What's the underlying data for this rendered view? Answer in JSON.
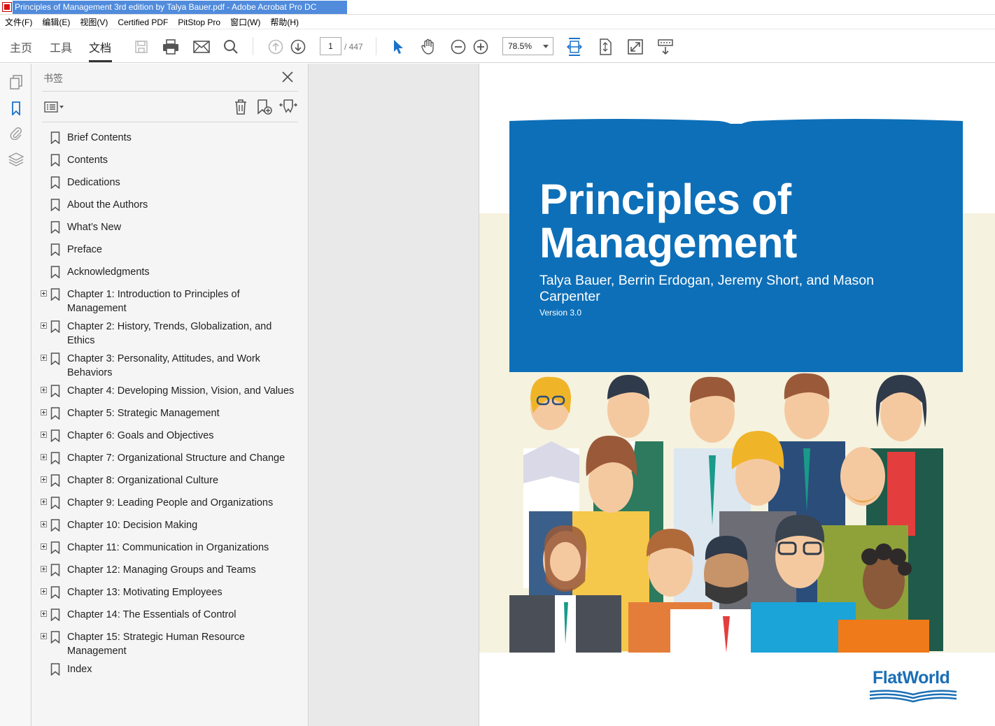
{
  "window": {
    "title": "Principles of Management 3rd edition by Talya Bauer.pdf - Adobe Acrobat Pro DC"
  },
  "menubar": [
    "文件(F)",
    "编辑(E)",
    "视图(V)",
    "Certified PDF",
    "PitStop Pro",
    "窗口(W)",
    "帮助(H)"
  ],
  "toolbar": {
    "tabs": [
      "主页",
      "工具",
      "文档"
    ],
    "active_tab": "文档",
    "page_current": "1",
    "page_total": "/ 447",
    "zoom": "78.5%"
  },
  "bookmarks_panel": {
    "title": "书签",
    "items": [
      {
        "label": "Brief Contents",
        "expandable": false
      },
      {
        "label": "Contents",
        "expandable": false
      },
      {
        "label": "Dedications",
        "expandable": false
      },
      {
        "label": "About the Authors",
        "expandable": false
      },
      {
        "label": "What’s New",
        "expandable": false
      },
      {
        "label": "Preface",
        "expandable": false
      },
      {
        "label": "Acknowledgments",
        "expandable": false
      },
      {
        "label": "Chapter 1: Introduction to Principles of Management",
        "expandable": true
      },
      {
        "label": "Chapter 2: History, Trends, Globalization, and Ethics",
        "expandable": true
      },
      {
        "label": "Chapter 3: Personality, Attitudes, and Work Behaviors",
        "expandable": true
      },
      {
        "label": "Chapter 4: Developing Mission, Vision, and Values",
        "expandable": true
      },
      {
        "label": "Chapter 5: Strategic Management",
        "expandable": true
      },
      {
        "label": "Chapter 6: Goals and Objectives",
        "expandable": true
      },
      {
        "label": "Chapter 7: Organizational Structure and Change",
        "expandable": true
      },
      {
        "label": "Chapter 8: Organizational Culture",
        "expandable": true
      },
      {
        "label": "Chapter 9: Leading People and Organizations",
        "expandable": true
      },
      {
        "label": "Chapter 10: Decision Making",
        "expandable": true
      },
      {
        "label": "Chapter 11: Communication in Organizations",
        "expandable": true
      },
      {
        "label": "Chapter 12: Managing Groups and Teams",
        "expandable": true
      },
      {
        "label": "Chapter 13: Motivating Employees",
        "expandable": true
      },
      {
        "label": "Chapter 14: The Essentials of Control",
        "expandable": true
      },
      {
        "label": "Chapter 15: Strategic Human Resource Management",
        "expandable": true
      },
      {
        "label": "Index",
        "expandable": false
      }
    ]
  },
  "cover": {
    "title": "Principles of Management",
    "authors": "Talya Bauer, Berrin Erdogan, Jeremy Short, and Mason Carpenter",
    "version": "Version 3.0",
    "publisher_logo": "FlatWorld"
  },
  "colors": {
    "cover_blue": "#0d6fb8",
    "cream": "#f5f2df",
    "acrobat_blue": "#1a73c9",
    "logo_blue": "#1a6fb6"
  }
}
